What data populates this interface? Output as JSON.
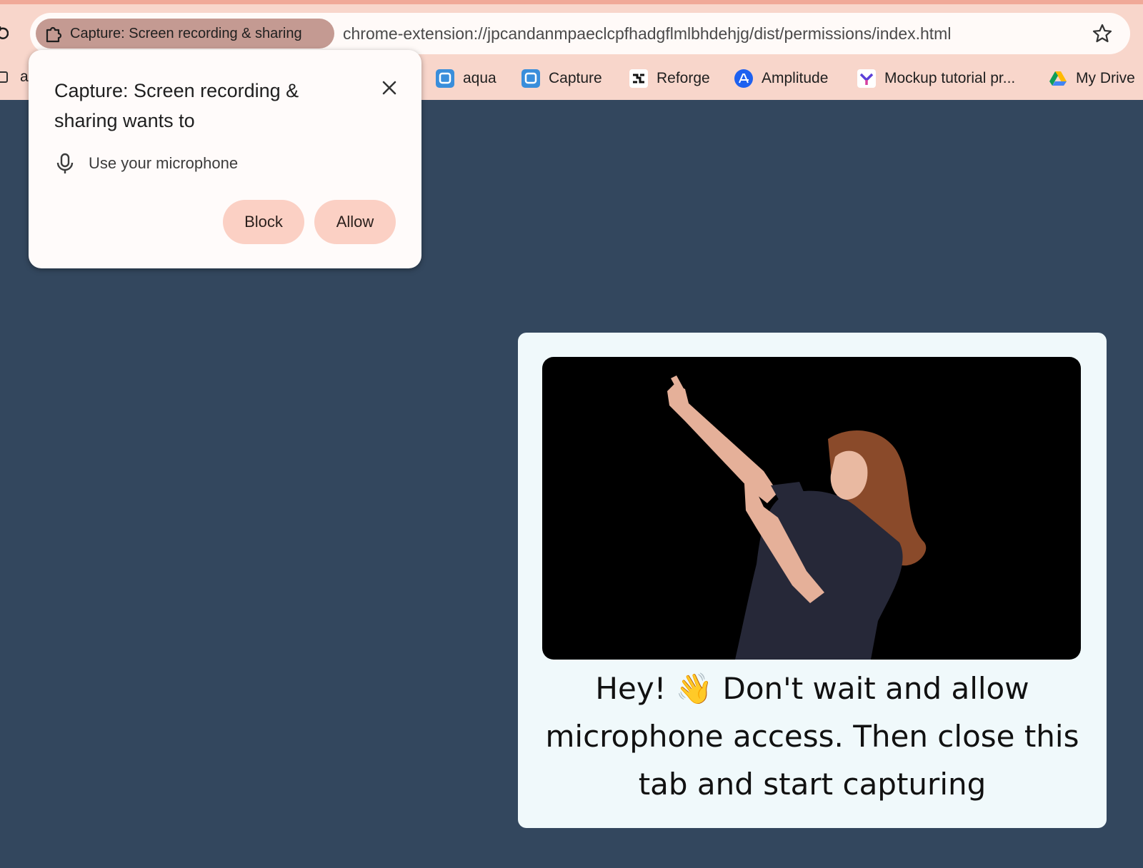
{
  "browser": {
    "origin_chip_label": "Capture: Screen recording & sharing",
    "url": "chrome-extension://jpcandanmpaeclcpfhadgflmlbhdehjg/dist/permissions/index.html",
    "icons": [
      "reload-icon",
      "extension-puzzle-icon",
      "star-icon"
    ]
  },
  "bookmarks": [
    {
      "label": "a",
      "icon": "bookmark-page-icon"
    },
    {
      "label": "aqua",
      "icon": "capture-app-icon"
    },
    {
      "label": "Capture",
      "icon": "capture-app-icon"
    },
    {
      "label": "Reforge",
      "icon": "reforge-icon"
    },
    {
      "label": "Amplitude",
      "icon": "amplitude-icon"
    },
    {
      "label": "Mockup tutorial pr...",
      "icon": "mockup-icon"
    },
    {
      "label": "My Drive",
      "icon": "google-drive-icon"
    }
  ],
  "permission_prompt": {
    "title": "Capture: Screen recording & sharing wants to",
    "permission": "Use your microphone",
    "block_label": "Block",
    "allow_label": "Allow"
  },
  "card": {
    "message": "Hey! 👋 Don't wait and allow microphone access. Then close this tab and start capturing"
  },
  "colors": {
    "chrome_bg": "#f8d6cb",
    "page_bg": "#33475e",
    "button_bg": "#fbd0c4",
    "card_bg": "#f0f9fb"
  }
}
